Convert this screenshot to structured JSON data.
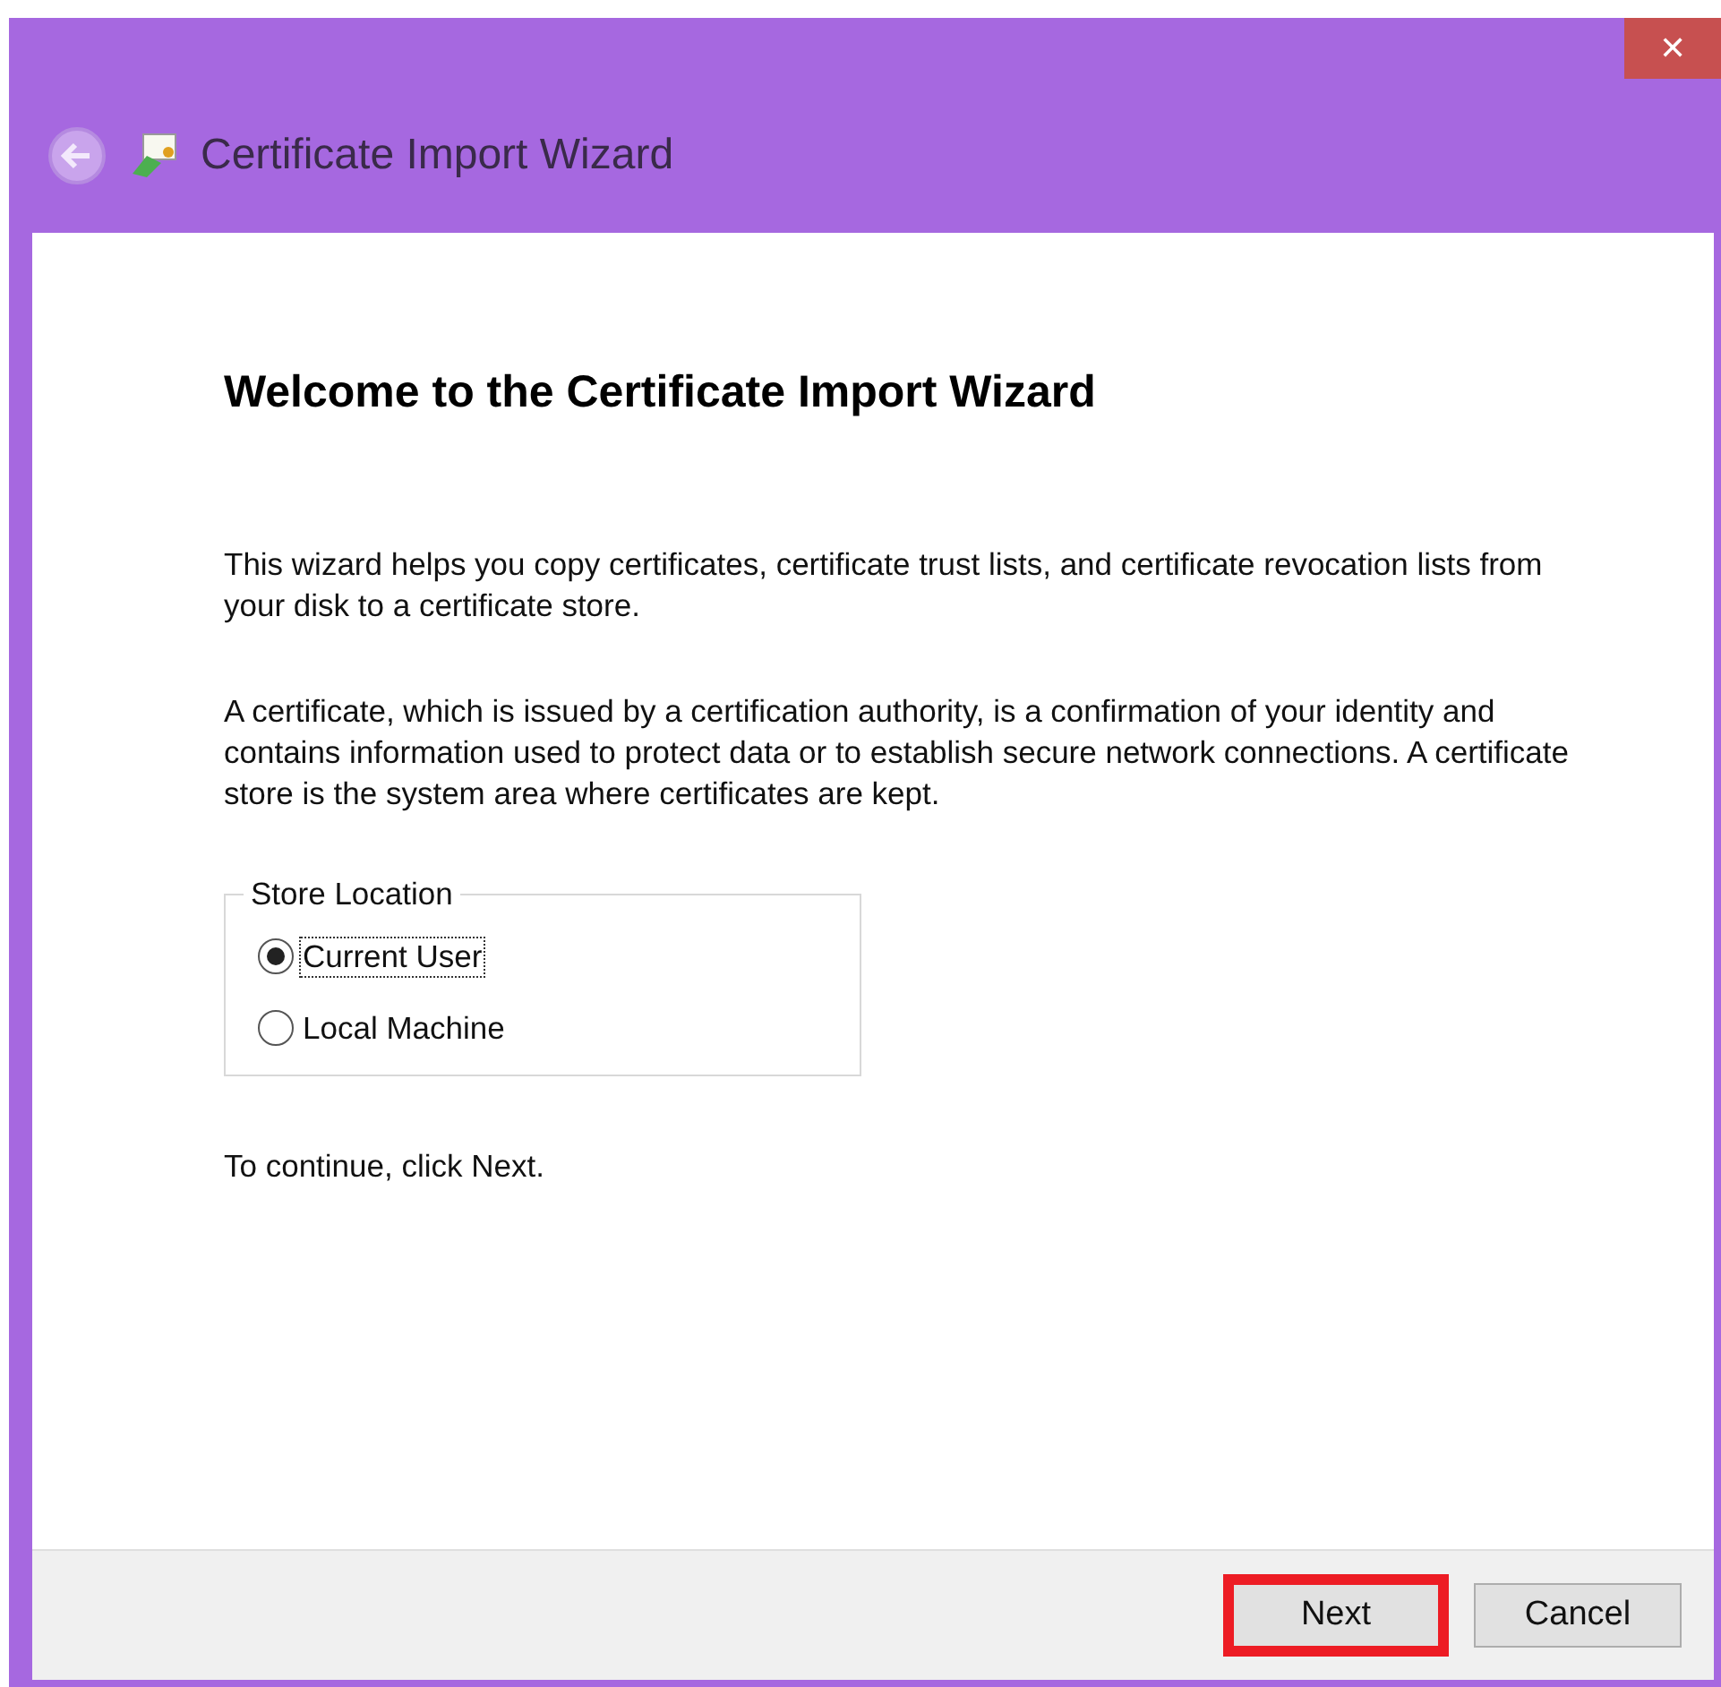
{
  "window": {
    "title": "Certificate Import Wizard",
    "close_label": "✕"
  },
  "heading": "Welcome to the Certificate Import Wizard",
  "paragraphs": [
    "This wizard helps you copy certificates, certificate trust lists, and certificate revocation lists from your disk to a certificate store.",
    "A certificate, which is issued by a certification authority, is a confirmation of your identity and contains information used to protect data or to establish secure network connections. A certificate store is the system area where certificates are kept."
  ],
  "store_location": {
    "label": "Store Location",
    "options": [
      {
        "label": "Current User",
        "selected": true
      },
      {
        "label": "Local Machine",
        "selected": false
      }
    ]
  },
  "hint": "To continue, click Next.",
  "buttons": [
    {
      "label": "Next",
      "highlighted": true
    },
    {
      "label": "Cancel",
      "highlighted": false
    }
  ]
}
